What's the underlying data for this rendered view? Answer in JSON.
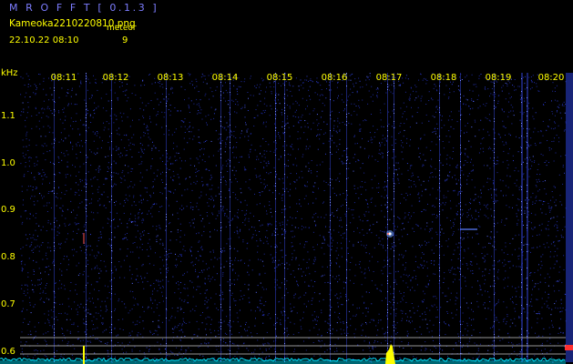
{
  "header": {
    "title": "M R O F F T  [ 0.1.3 ]",
    "filename": "Kameoka2210220810.png",
    "meteor_label": "meteor",
    "datetime": "22.10.22  08:10",
    "meteor_count": "9"
  },
  "spectrogram": {
    "y_unit": "kHz",
    "time_ticks": [
      "08:11",
      "08:12",
      "08:13",
      "08:14",
      "08:15",
      "08:16",
      "08:17",
      "08:18",
      "08:19",
      "08:20"
    ],
    "freq_ticks": [
      {
        "label": "1.1",
        "value": 1.1
      },
      {
        "label": "1.0",
        "value": 1.0
      },
      {
        "label": "0.9",
        "value": 0.9
      },
      {
        "label": "0.8",
        "value": 0.8
      },
      {
        "label": "0.7",
        "value": 0.7
      },
      {
        "label": "0.6",
        "value": 0.6
      }
    ],
    "freq_range": [
      0.58,
      1.2
    ],
    "colors": {
      "background": "#000000",
      "noise": "#1e2aa0",
      "text": "#ffff00",
      "title": "#7d7dff",
      "baseline": "#00e5ff",
      "marker": "#ffff00",
      "grid_line": "#c8c8c8"
    }
  }
}
